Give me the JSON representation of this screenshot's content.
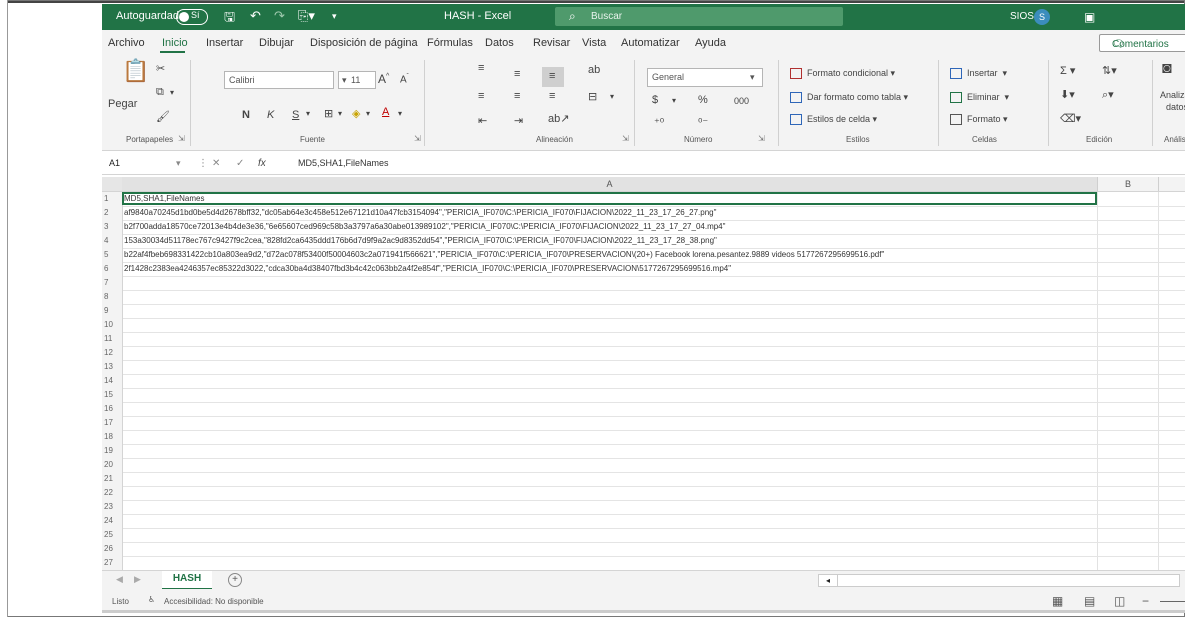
{
  "titlebar": {
    "autosave_label": "Autoguardado",
    "autosave_state": "Sí",
    "doc_title": "HASH - Excel",
    "search_placeholder": "Buscar",
    "user": "SIOS",
    "avatar_initial": "S"
  },
  "menu": {
    "tabs": [
      "Archivo",
      "Inicio",
      "Insertar",
      "Dibujar",
      "Disposición de página",
      "Fórmulas",
      "Datos",
      "Revisar",
      "Vista",
      "Automatizar",
      "Ayuda"
    ],
    "active": "Inicio",
    "comments_label": "Comentarios"
  },
  "ribbon": {
    "clipboard": {
      "paste": "Pegar",
      "label": "Portapapeles"
    },
    "font": {
      "name": "Calibri",
      "size": "11",
      "bold": "N",
      "italic": "K",
      "underline": "S",
      "label": "Fuente"
    },
    "alignment": {
      "label": "Alineación"
    },
    "number": {
      "format": "General",
      "currency": "$",
      "percent": "%",
      "thousands": "000",
      "label": "Número"
    },
    "styles": {
      "conditional": "Formato condicional",
      "table": "Dar formato como tabla",
      "cell_styles": "Estilos de celda",
      "label": "Estilos"
    },
    "cells": {
      "insert": "Insertar",
      "delete": "Eliminar",
      "format": "Formato",
      "label": "Celdas"
    },
    "editing": {
      "label": "Edición"
    },
    "analysis": {
      "label": "Análisis",
      "btn1": "Analizar",
      "btn2": "datos"
    }
  },
  "formula_bar": {
    "name_box": "A1",
    "fx": "fx",
    "content": "MD5,SHA1,FileNames"
  },
  "grid": {
    "columns": [
      "A",
      "B"
    ],
    "rows": [
      "MD5,SHA1,FileNames",
      "af9840a70245d1bd0be5d4d2678bff32,\"dc05ab64e3c458e512e67121d10a47fcb3154094\",\"PERICIA_IF070\\C:\\PERICIA_IF070\\FIJACION\\2022_11_23_17_26_27.png\"",
      "b2f700adda18570ce72013e4b4de3e36,\"6e65607ced969c58b3a3797a6a30abe013989102\",\"PERICIA_IF070\\C:\\PERICIA_IF070\\FIJACION\\2022_11_23_17_27_04.mp4\"",
      "153a30034d51178ec767c9427f9c2cea,\"828fd2ca6435ddd176b6d7d9f9a2ac9d8352dd54\",\"PERICIA_IF070\\C:\\PERICIA_IF070\\FIJACION\\2022_11_23_17_28_38.png\"",
      "b22af4fbeb698331422cb10a803ea9d2,\"d72ac078f53400f50004603c2a071941f566621\",\"PERICIA_IF070\\C:\\PERICIA_IF070\\PRESERVACION\\(20+) Facebook lorena.pesantez.9889 videos 5177267295699516.pdf\"",
      "2f1428c2383ea4246357ec85322d3022,\"cdca30ba4d38407fbd3b4c42c063bb2a4f2e854f\",\"PERICIA_IF070\\C:\\PERICIA_IF070\\PRESERVACION\\5177267295699516.mp4\"",
      "",
      "",
      "",
      "",
      "",
      "",
      "",
      "",
      "",
      "",
      "",
      "",
      "",
      "",
      "",
      "",
      "",
      "",
      "",
      "",
      ""
    ],
    "row_numbers": [
      "1",
      "2",
      "3",
      "4",
      "5",
      "6",
      "7",
      "8",
      "9",
      "10",
      "11",
      "12",
      "13",
      "14",
      "15",
      "16",
      "17",
      "18",
      "19",
      "20",
      "21",
      "22",
      "23",
      "24",
      "25",
      "26",
      "27"
    ]
  },
  "sheets": {
    "tabs": [
      "HASH"
    ],
    "add_label": "+"
  },
  "status": {
    "ready": "Listo",
    "accessibility": "Accesibilidad: No disponible"
  }
}
